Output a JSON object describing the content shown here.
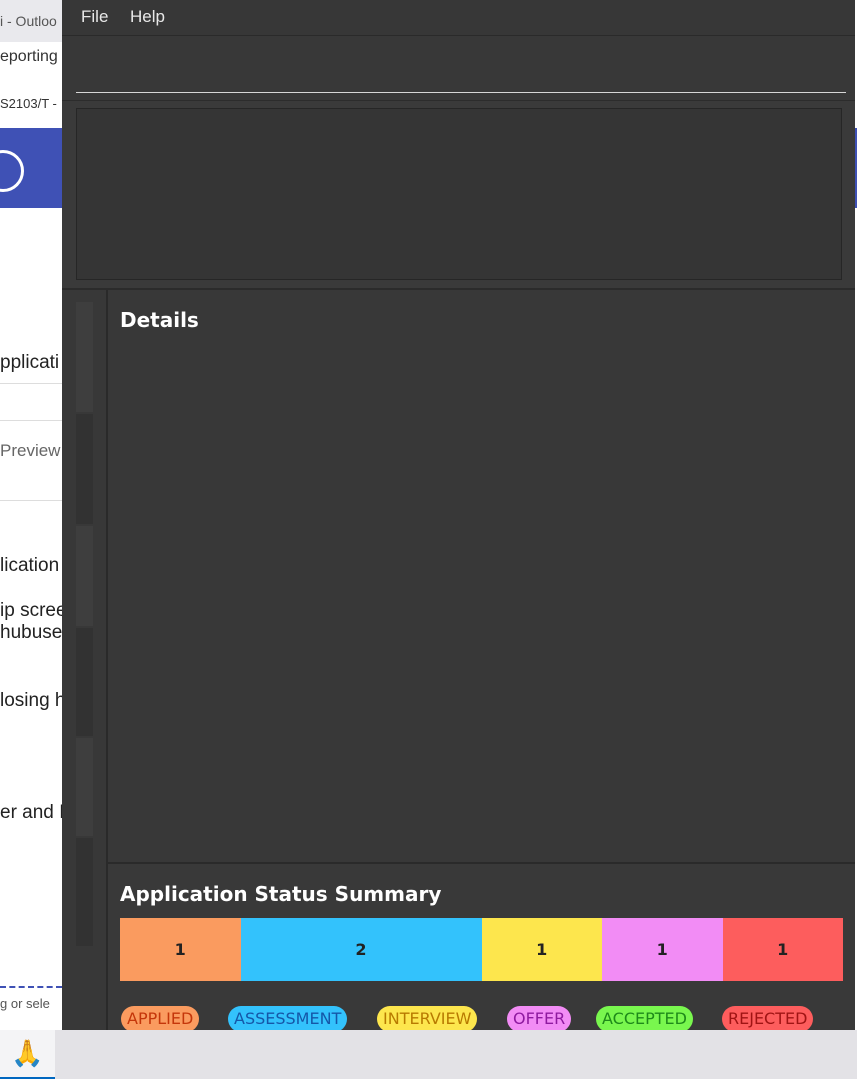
{
  "background": {
    "tab_text": "i - Outloo",
    "bookmark_text": "eporting",
    "course_text": "S2103/T -",
    "heading_text": "pplicati",
    "preview_text": "Preview",
    "body_lines": [
      "lication",
      "ip scree",
      "hubuse",
      "losing h",
      "er and I"
    ],
    "drop_text": "g or sele"
  },
  "window": {
    "menu": {
      "file": "File",
      "help": "Help"
    },
    "command": {
      "value": "",
      "placeholder": ""
    },
    "result_text": "",
    "details": {
      "title": "Details"
    },
    "summary": {
      "title": "Application Status Summary",
      "segments": [
        {
          "label": "1",
          "value": 1,
          "color": "#fa9b5f"
        },
        {
          "label": "2",
          "value": 2,
          "color": "#33c2fc"
        },
        {
          "label": "1",
          "value": 1,
          "color": "#fde64d"
        },
        {
          "label": "1",
          "value": 1,
          "color": "#f28cf5"
        },
        {
          "label": "1",
          "value": 1,
          "color": "#fd5d5d"
        }
      ],
      "legend": [
        {
          "label": "APPLIED",
          "bg": "#fa9b5f",
          "fg": "#c4360a"
        },
        {
          "label": "ASSESSMENT",
          "bg": "#33c2fc",
          "fg": "#1557a8"
        },
        {
          "label": "INTERVIEW",
          "bg": "#fde64d",
          "fg": "#b87a00"
        },
        {
          "label": "OFFER",
          "bg": "#f28cf5",
          "fg": "#8f1aa0"
        },
        {
          "label": "ACCEPTED",
          "bg": "#79f74e",
          "fg": "#1e8a1a"
        },
        {
          "label": "REJECTED",
          "bg": "#fd5d5d",
          "fg": "#a01414"
        }
      ]
    }
  },
  "taskbar": {
    "app_icon": "🙏"
  }
}
